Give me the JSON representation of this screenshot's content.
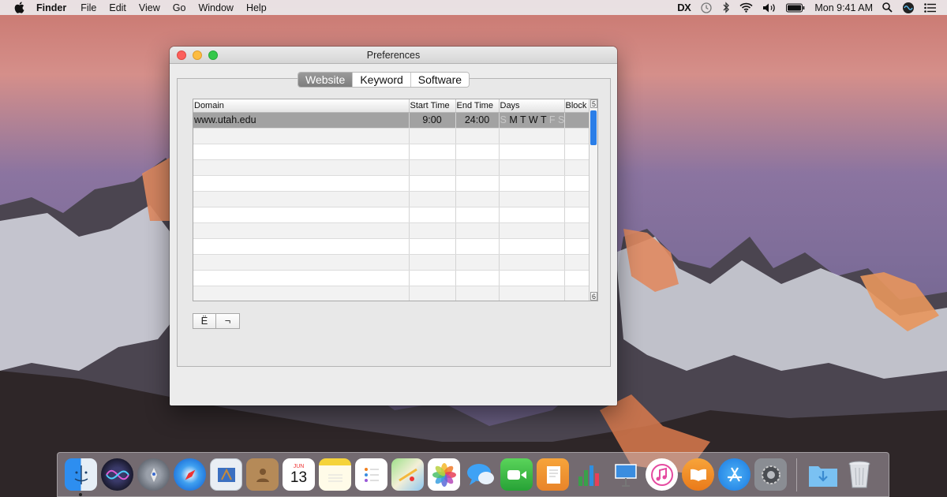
{
  "menubar": {
    "app_name": "Finder",
    "menus": [
      "File",
      "Edit",
      "View",
      "Go",
      "Window",
      "Help"
    ],
    "status_dx": "DX",
    "clock": "Mon 9:41 AM"
  },
  "window": {
    "title": "Preferences",
    "tabs": [
      {
        "label": "Website",
        "active": true
      },
      {
        "label": "Keyword",
        "active": false
      },
      {
        "label": "Software",
        "active": false
      }
    ],
    "table": {
      "columns": [
        "Domain",
        "Start Time",
        "End Time",
        "Days",
        "Block"
      ],
      "rows": [
        {
          "domain": "www.utah.edu",
          "start_time": "9:00",
          "end_time": "24:00",
          "days": [
            {
              "letter": "S",
              "on": false
            },
            {
              "letter": "M",
              "on": true
            },
            {
              "letter": "T",
              "on": true
            },
            {
              "letter": "W",
              "on": true
            },
            {
              "letter": "T",
              "on": true
            },
            {
              "letter": "F",
              "on": false
            },
            {
              "letter": "S",
              "on": false
            }
          ],
          "block": "",
          "selected": true
        }
      ],
      "empty_row_count": 11,
      "scroll_up_glyph": "5",
      "scroll_down_glyph": "6"
    },
    "buttons": {
      "add_label": "Ë",
      "remove_label": "¬"
    }
  },
  "dock": {
    "icons": [
      "finder-icon",
      "siri-icon",
      "launchpad-icon",
      "safari-icon",
      "mail-icon",
      "contacts-icon",
      "calendar-icon",
      "notes-icon",
      "reminders-icon",
      "maps-icon",
      "photos-icon",
      "messages-icon",
      "facetime-icon",
      "pages-icon",
      "numbers-icon",
      "keynote-icon",
      "itunes-icon",
      "ibooks-icon",
      "app-store-icon",
      "system-preferences-icon",
      "downloads-folder-icon",
      "trash-icon"
    ],
    "calendar_month": "JUN",
    "calendar_day": "13"
  }
}
